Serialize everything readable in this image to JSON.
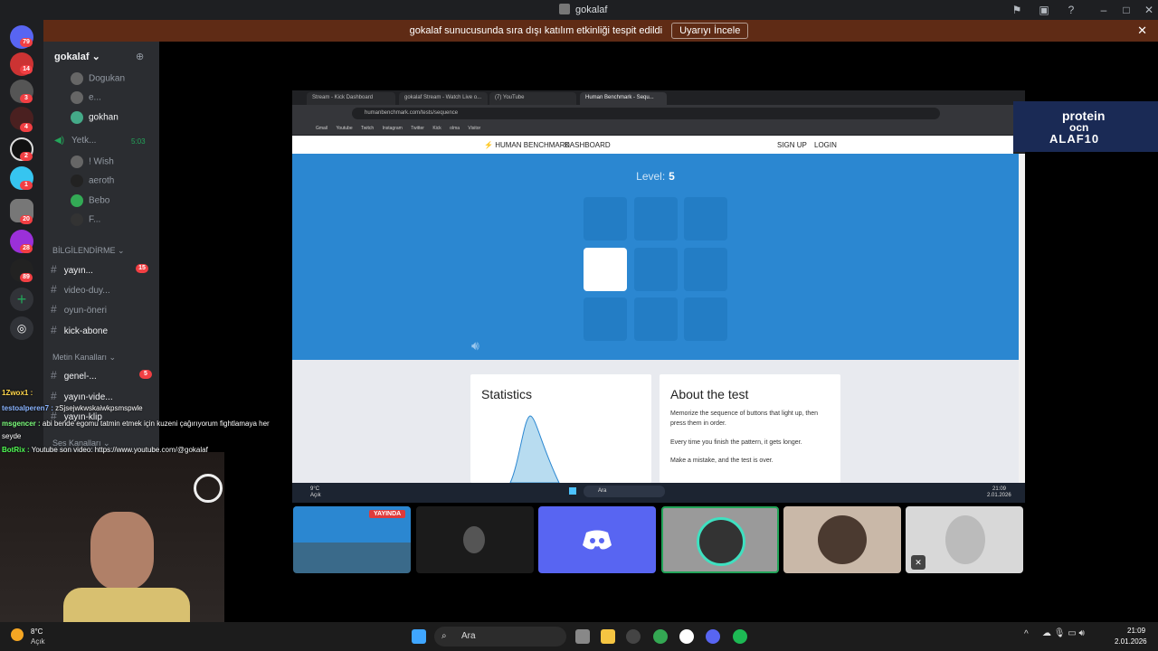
{
  "window": {
    "title": "gokalaf"
  },
  "notice": {
    "text": "gokalaf sunucusunda sıra dışı katılım etkinliği tespit edildi",
    "button": "Uyarıyı İncele"
  },
  "rail_badges": [
    "79",
    "14",
    "3",
    "4",
    "2",
    "1",
    "20",
    "28",
    "89"
  ],
  "server": {
    "name": "gokalaf"
  },
  "voice_users": [
    "Dogukan",
    "e...",
    "gokhan"
  ],
  "voice_channel": {
    "name": "Yetk...",
    "timer": "5:03"
  },
  "voice_users2": [
    "! Wish",
    "aeroth",
    "Bebo",
    "F..."
  ],
  "cat_info": "BİLGİLENDİRME",
  "info_channels": [
    {
      "name": "yayın...",
      "badge": "15"
    },
    {
      "name": "video-duy..."
    },
    {
      "name": "oyun-öneri"
    },
    {
      "name": "kick-abone"
    }
  ],
  "cat_text": "Metin Kanalları",
  "text_channels": [
    {
      "name": "genel-...",
      "badge": "5"
    },
    {
      "name": "yayın-vide..."
    },
    {
      "name": "yayın-klip"
    }
  ],
  "cat_voice": "Ses Kanalları",
  "chat": [
    {
      "user": "1Zwox1 :",
      "msg": "",
      "color": "#ffd54a"
    },
    {
      "user": "testoalperen7 :",
      "msg": "zSjsejwkwskaiwkpsmspwle",
      "color": "#8ab4ff"
    },
    {
      "user": "msgencer :",
      "msg": "abi bende egomu tatmin etmek için kuzeni çağırıyorum fightlamaya her",
      "color": "#7dff7d"
    },
    {
      "user": "",
      "msg": "seyde",
      "color": "#ffffff"
    },
    {
      "user": "BotRix :",
      "msg": "Youtube son video: https://www.youtube.com/@gokalaf",
      "color": "#52ff52"
    }
  ],
  "browser": {
    "tabs": [
      "Stream - Kick Dashboard",
      "gokalaf Stream - Watch Live o...",
      "(7) YouTube",
      "Human Benchmark - Sequ..."
    ],
    "url": "humanbenchmark.com/tests/sequence",
    "bookmarks": [
      "Gmail",
      "Youtube",
      "Twitch",
      "Instagram",
      "Twitter",
      "Kick",
      "olma",
      "Visitor"
    ]
  },
  "hb": {
    "brand": "HUMAN BENCHMARK",
    "dashboard": "DASHBOARD",
    "signup": "SIGN UP",
    "login": "LOGIN",
    "level_label": "Level:",
    "level_value": "5",
    "stats_title": "Statistics",
    "about_title": "About the test",
    "about_p1": "Memorize the sequence of buttons that light up, then press them in order.",
    "about_p2": "Every time you finish the pattern, it gets longer.",
    "about_p3": "Make a mistake, and the test is over."
  },
  "inner_taskbar": {
    "weather": "9°C",
    "weather_sub": "Açık",
    "search": "Ara",
    "time": "21:09",
    "date": "2.01.2026"
  },
  "live_badge": "YAYINDA",
  "promo": {
    "line1": "protein",
    "line2": "ocn",
    "line3": "ALAF10"
  },
  "taskbar": {
    "weather": "8°C",
    "weather_sub": "Açık",
    "search": "Ara",
    "time": "21:09",
    "date": "2.01.2026"
  }
}
